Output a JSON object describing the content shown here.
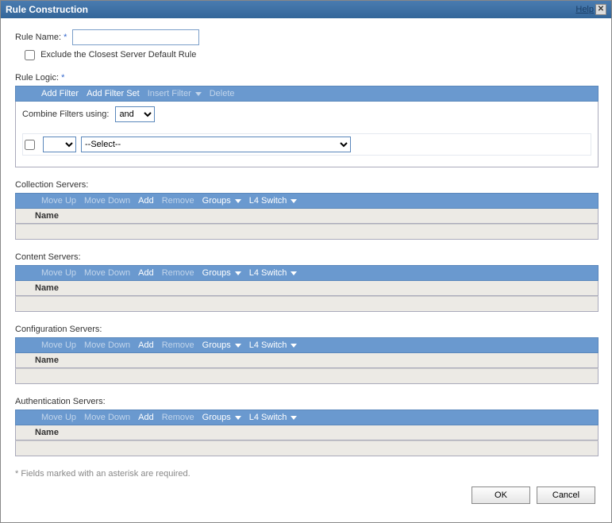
{
  "window": {
    "title": "Rule Construction",
    "help": "Help"
  },
  "form": {
    "ruleNameLabel": "Rule Name:",
    "ruleNameValue": "",
    "excludeLabel": "Exclude the Closest Server Default Rule",
    "ruleLogicLabel": "Rule Logic:",
    "combineLabel": "Combine Filters using:",
    "combineValue": "and",
    "filterSelectPlaceholder": "--Select--"
  },
  "ruleToolbar": {
    "addFilter": "Add Filter",
    "addFilterSet": "Add Filter Set",
    "insertFilter": "Insert Filter",
    "delete": "Delete"
  },
  "serverToolbar": {
    "moveUp": "Move Up",
    "moveDown": "Move Down",
    "add": "Add",
    "remove": "Remove",
    "groups": "Groups",
    "l4switch": "L4 Switch"
  },
  "tableHeader": {
    "name": "Name"
  },
  "sections": {
    "collection": "Collection Servers:",
    "content": "Content Servers:",
    "configuration": "Configuration Servers:",
    "authentication": "Authentication Servers:"
  },
  "footnote": "* Fields marked with an asterisk are required.",
  "buttons": {
    "ok": "OK",
    "cancel": "Cancel"
  }
}
